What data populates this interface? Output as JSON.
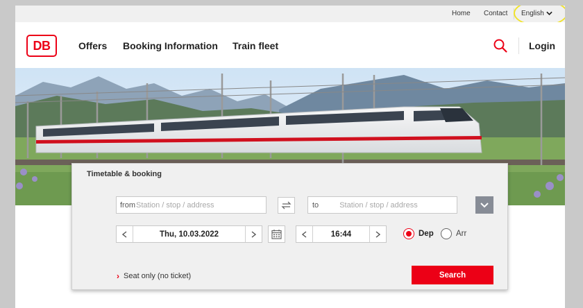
{
  "topbar": {
    "home": "Home",
    "contact": "Contact",
    "language": "English"
  },
  "header": {
    "logo": "DB",
    "nav": [
      "Offers",
      "Booking Information",
      "Train fleet"
    ],
    "login": "Login"
  },
  "booking": {
    "title": "Timetable & booking",
    "from_label": "from",
    "from_placeholder": "Station / stop / address",
    "to_label": "to",
    "to_placeholder": "Station / stop / address",
    "date": "Thu, 10.03.2022",
    "time": "16:44",
    "dep_label": "Dep",
    "arr_label": "Arr",
    "selected_mode": "Dep",
    "seat_only": "Seat only (no ticket)",
    "search_button": "Search"
  },
  "colors": {
    "brand_red": "#ec0016",
    "highlight": "#f1e32a",
    "panel_bg": "#f0f0f0"
  }
}
